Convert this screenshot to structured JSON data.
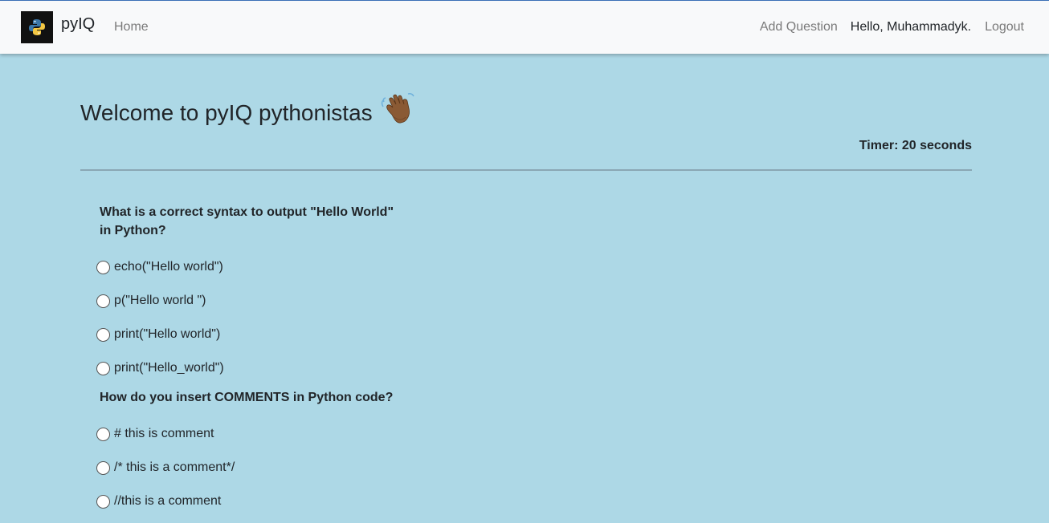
{
  "nav": {
    "brand": "pyIQ",
    "home": "Home",
    "add_question": "Add Question",
    "greeting": "Hello, Muhammadyk.",
    "logout": "Logout"
  },
  "main": {
    "welcome": "Welcome to pyIQ pythonistas",
    "timer": "Timer: 20 seconds"
  },
  "questions": [
    {
      "text": "What is a correct syntax to output \"Hello World\" in Python?",
      "options": [
        "echo(\"Hello world\")",
        "p(\"Hello world \")",
        "print(\"Hello world\")",
        "print(\"Hello_world\")"
      ]
    },
    {
      "text": "How do you insert COMMENTS in Python code?",
      "options": [
        "# this is comment",
        "/* this is a comment*/",
        "//this is a comment"
      ]
    }
  ]
}
